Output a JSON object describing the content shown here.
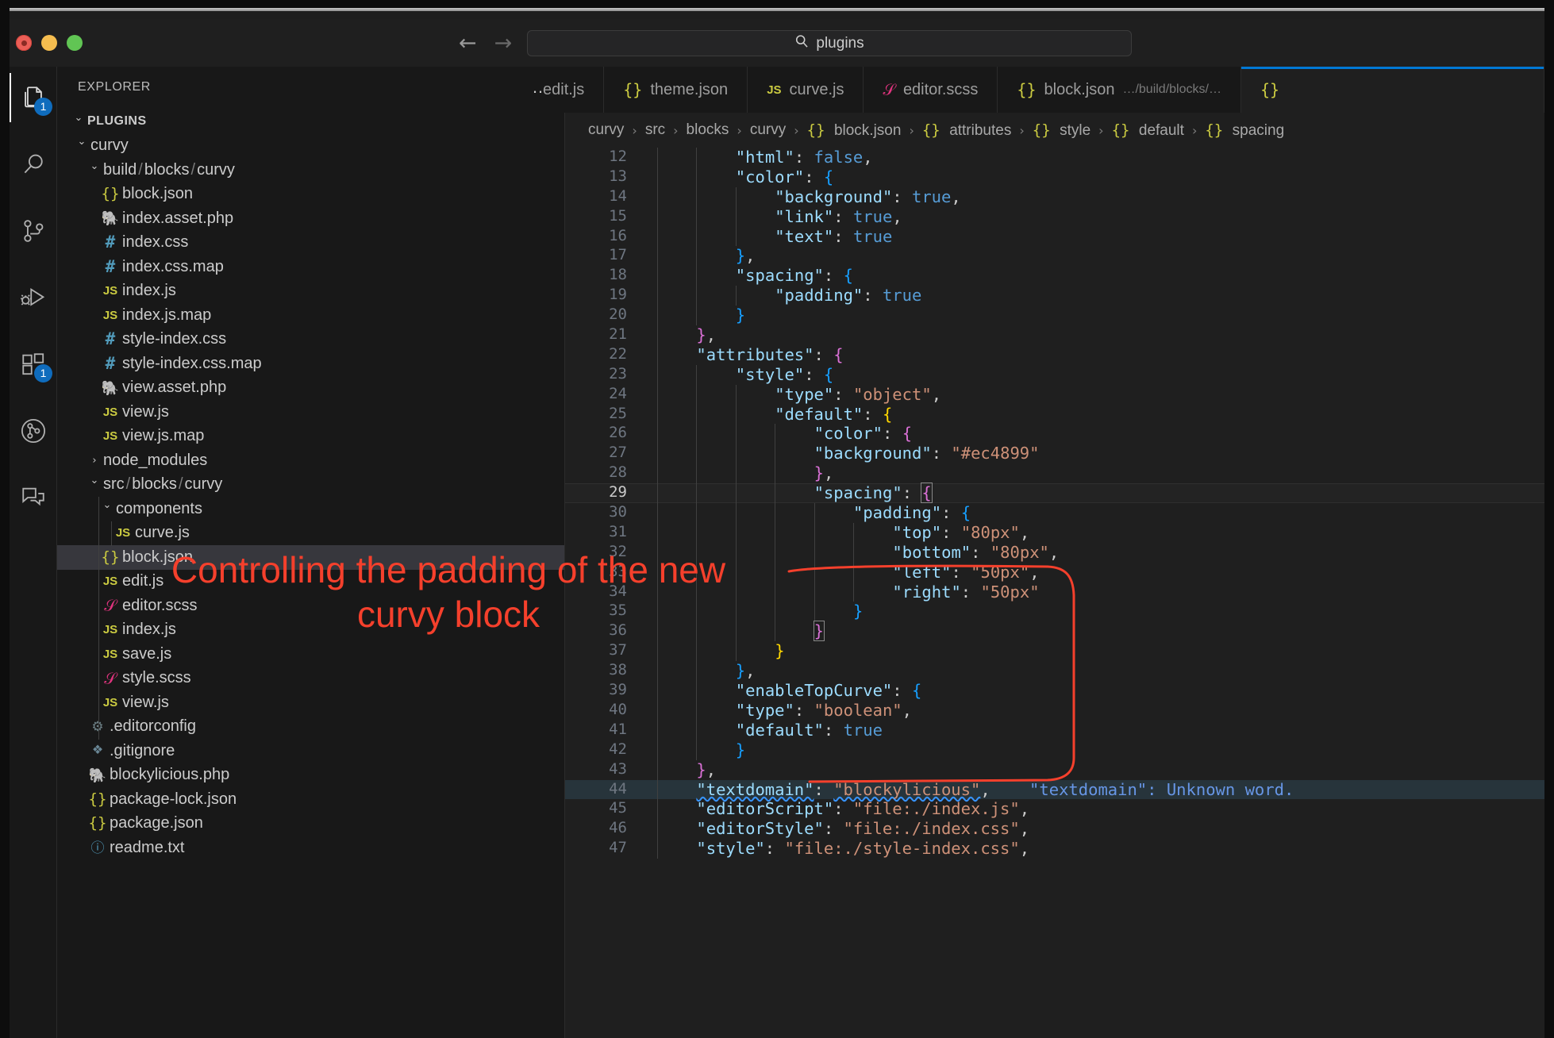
{
  "window": {
    "traffic_lights": [
      "close",
      "minimize",
      "maximize"
    ],
    "search_placeholder": "plugins",
    "search_value": "plugins",
    "nav_back": "←",
    "nav_forward": "→",
    "search_icon": "⌕"
  },
  "activitybar": {
    "items": [
      {
        "name": "explorer",
        "icon": "files-icon",
        "badge": "1",
        "active": true
      },
      {
        "name": "search",
        "icon": "search-icon",
        "badge": "",
        "active": false
      },
      {
        "name": "source-control",
        "icon": "source-control-icon",
        "badge": "",
        "active": false
      },
      {
        "name": "run-and-debug",
        "icon": "run-debug-icon",
        "badge": "",
        "active": false
      },
      {
        "name": "extensions",
        "icon": "extensions-icon",
        "badge": "1",
        "active": false
      },
      {
        "name": "git-graph",
        "icon": "git-graph-icon",
        "badge": "",
        "active": false
      },
      {
        "name": "comments",
        "icon": "comments-icon",
        "badge": "",
        "active": false
      }
    ]
  },
  "sidebar": {
    "title": "EXPLORER",
    "more_actions": "…",
    "root": {
      "label": "PLUGINS",
      "expanded": true
    },
    "tree": [
      {
        "label": "curvy",
        "kind": "folder",
        "depth": 1,
        "expanded": true,
        "icon": "chevron-down-icon"
      },
      {
        "label": "build",
        "label2": "blocks",
        "label3": "curvy",
        "kind": "folder-compact",
        "depth": 2,
        "expanded": true,
        "icon": "chevron-down-icon"
      },
      {
        "label": "block.json",
        "kind": "file",
        "depth": 3,
        "icon": "json-icon"
      },
      {
        "label": "index.asset.php",
        "kind": "file",
        "depth": 3,
        "icon": "php-icon"
      },
      {
        "label": "index.css",
        "kind": "file",
        "depth": 3,
        "icon": "css-icon"
      },
      {
        "label": "index.css.map",
        "kind": "file",
        "depth": 3,
        "icon": "css-icon"
      },
      {
        "label": "index.js",
        "kind": "file",
        "depth": 3,
        "icon": "js-icon"
      },
      {
        "label": "index.js.map",
        "kind": "file",
        "depth": 3,
        "icon": "js-icon"
      },
      {
        "label": "style-index.css",
        "kind": "file",
        "depth": 3,
        "icon": "css-icon"
      },
      {
        "label": "style-index.css.map",
        "kind": "file",
        "depth": 3,
        "icon": "css-icon"
      },
      {
        "label": "view.asset.php",
        "kind": "file",
        "depth": 3,
        "icon": "php-icon"
      },
      {
        "label": "view.js",
        "kind": "file",
        "depth": 3,
        "icon": "js-icon"
      },
      {
        "label": "view.js.map",
        "kind": "file",
        "depth": 3,
        "icon": "js-icon"
      },
      {
        "label": "node_modules",
        "kind": "folder",
        "depth": 2,
        "expanded": false,
        "icon": "chevron-right-icon"
      },
      {
        "label": "src",
        "label2": "blocks",
        "label3": "curvy",
        "kind": "folder-compact",
        "depth": 2,
        "expanded": true,
        "icon": "chevron-down-icon"
      },
      {
        "label": "components",
        "kind": "folder",
        "depth": 3,
        "expanded": true,
        "icon": "chevron-down-icon"
      },
      {
        "label": "curve.js",
        "kind": "file",
        "depth": 4,
        "icon": "js-icon"
      },
      {
        "label": "block.json",
        "kind": "file",
        "depth": 3,
        "icon": "json-icon",
        "selected": true
      },
      {
        "label": "edit.js",
        "kind": "file",
        "depth": 3,
        "icon": "js-icon"
      },
      {
        "label": "editor.scss",
        "kind": "file",
        "depth": 3,
        "icon": "scss-icon"
      },
      {
        "label": "index.js",
        "kind": "file",
        "depth": 3,
        "icon": "js-icon"
      },
      {
        "label": "save.js",
        "kind": "file",
        "depth": 3,
        "icon": "js-icon"
      },
      {
        "label": "style.scss",
        "kind": "file",
        "depth": 3,
        "icon": "scss-icon"
      },
      {
        "label": "view.js",
        "kind": "file",
        "depth": 3,
        "icon": "js-icon"
      },
      {
        "label": ".editorconfig",
        "kind": "file",
        "depth": 2,
        "icon": "gear-icon"
      },
      {
        "label": ".gitignore",
        "kind": "file",
        "depth": 2,
        "icon": "git-icon"
      },
      {
        "label": "blockylicious.php",
        "kind": "file",
        "depth": 2,
        "icon": "php-icon"
      },
      {
        "label": "package-lock.json",
        "kind": "file",
        "depth": 2,
        "icon": "json-icon"
      },
      {
        "label": "package.json",
        "kind": "file",
        "depth": 2,
        "icon": "json-icon"
      },
      {
        "label": "readme.txt",
        "kind": "file",
        "depth": 2,
        "icon": "txt-icon"
      }
    ]
  },
  "tabs": [
    {
      "label": "edit.js",
      "icon": "js-icon",
      "sub": "",
      "active": false,
      "clipped": true
    },
    {
      "label": "theme.json",
      "icon": "json-icon",
      "sub": "",
      "active": false
    },
    {
      "label": "curve.js",
      "icon": "js-icon",
      "sub": "",
      "active": false
    },
    {
      "label": "editor.scss",
      "icon": "scss-icon",
      "sub": "",
      "active": false
    },
    {
      "label": "block.json",
      "icon": "json-icon",
      "sub": "…/build/blocks/…",
      "active": false
    },
    {
      "label": "",
      "icon": "json-icon",
      "sub": "",
      "active": true
    }
  ],
  "breadcrumbs": [
    {
      "label": "curvy",
      "icon": ""
    },
    {
      "label": "src",
      "icon": ""
    },
    {
      "label": "blocks",
      "icon": ""
    },
    {
      "label": "curvy",
      "icon": ""
    },
    {
      "label": "block.json",
      "icon": "{}"
    },
    {
      "label": "attributes",
      "icon": "{}"
    },
    {
      "label": "style",
      "icon": "{}"
    },
    {
      "label": "default",
      "icon": "{}"
    },
    {
      "label": "spacing",
      "icon": "{}"
    }
  ],
  "code": {
    "first_line": 12,
    "current_line": 29,
    "lines": [
      {
        "n": 12,
        "indent": 2,
        "tokens": [
          {
            "t": "\"html\"",
            "c": "k"
          },
          {
            "t": ": ",
            "c": "p"
          },
          {
            "t": "false",
            "c": "b"
          },
          {
            "t": ",",
            "c": "p"
          }
        ]
      },
      {
        "n": 13,
        "indent": 2,
        "tokens": [
          {
            "t": "\"color\"",
            "c": "k"
          },
          {
            "t": ": ",
            "c": "p"
          },
          {
            "t": "{",
            "c": "bk3"
          }
        ]
      },
      {
        "n": 14,
        "indent": 3,
        "tokens": [
          {
            "t": "\"background\"",
            "c": "k"
          },
          {
            "t": ": ",
            "c": "p"
          },
          {
            "t": "true",
            "c": "b"
          },
          {
            "t": ",",
            "c": "p"
          }
        ]
      },
      {
        "n": 15,
        "indent": 3,
        "tokens": [
          {
            "t": "\"link\"",
            "c": "k"
          },
          {
            "t": ": ",
            "c": "p"
          },
          {
            "t": "true",
            "c": "b"
          },
          {
            "t": ",",
            "c": "p"
          }
        ]
      },
      {
        "n": 16,
        "indent": 3,
        "tokens": [
          {
            "t": "\"text\"",
            "c": "k"
          },
          {
            "t": ": ",
            "c": "p"
          },
          {
            "t": "true",
            "c": "b"
          }
        ]
      },
      {
        "n": 17,
        "indent": 2,
        "tokens": [
          {
            "t": "}",
            "c": "bk3"
          },
          {
            "t": ",",
            "c": "p"
          }
        ]
      },
      {
        "n": 18,
        "indent": 2,
        "tokens": [
          {
            "t": "\"spacing\"",
            "c": "k"
          },
          {
            "t": ": ",
            "c": "p"
          },
          {
            "t": "{",
            "c": "bk3"
          }
        ]
      },
      {
        "n": 19,
        "indent": 3,
        "tokens": [
          {
            "t": "\"padding\"",
            "c": "k"
          },
          {
            "t": ": ",
            "c": "p"
          },
          {
            "t": "true",
            "c": "b"
          }
        ]
      },
      {
        "n": 20,
        "indent": 2,
        "tokens": [
          {
            "t": "}",
            "c": "bk3"
          }
        ]
      },
      {
        "n": 21,
        "indent": 1,
        "tokens": [
          {
            "t": "}",
            "c": "bk2"
          },
          {
            "t": ",",
            "c": "p"
          }
        ]
      },
      {
        "n": 22,
        "indent": 1,
        "tokens": [
          {
            "t": "\"attributes\"",
            "c": "k"
          },
          {
            "t": ": ",
            "c": "p"
          },
          {
            "t": "{",
            "c": "bk2"
          }
        ]
      },
      {
        "n": 23,
        "indent": 2,
        "tokens": [
          {
            "t": "\"style\"",
            "c": "k"
          },
          {
            "t": ": ",
            "c": "p"
          },
          {
            "t": "{",
            "c": "bk3"
          }
        ]
      },
      {
        "n": 24,
        "indent": 3,
        "tokens": [
          {
            "t": "\"type\"",
            "c": "k"
          },
          {
            "t": ": ",
            "c": "p"
          },
          {
            "t": "\"object\"",
            "c": "s"
          },
          {
            "t": ",",
            "c": "p"
          }
        ]
      },
      {
        "n": 25,
        "indent": 3,
        "tokens": [
          {
            "t": "\"default\"",
            "c": "k"
          },
          {
            "t": ": ",
            "c": "p"
          },
          {
            "t": "{",
            "c": "bk1"
          }
        ]
      },
      {
        "n": 26,
        "indent": 4,
        "tokens": [
          {
            "t": "\"color\"",
            "c": "k"
          },
          {
            "t": ": ",
            "c": "p"
          },
          {
            "t": "{",
            "c": "bk2"
          }
        ]
      },
      {
        "n": 27,
        "indent": 4,
        "tokens": [
          {
            "t": "\"background\"",
            "c": "k"
          },
          {
            "t": ": ",
            "c": "p"
          },
          {
            "t": "\"#ec4899\"",
            "c": "s"
          }
        ]
      },
      {
        "n": 28,
        "indent": 4,
        "tokens": [
          {
            "t": "}",
            "c": "bk2"
          },
          {
            "t": ",",
            "c": "p"
          }
        ]
      },
      {
        "n": 29,
        "indent": 4,
        "tokens": [
          {
            "t": "\"spacing\"",
            "c": "k"
          },
          {
            "t": ": ",
            "c": "p"
          },
          {
            "t": "{",
            "c": "bk2 mbk"
          }
        ],
        "current": true
      },
      {
        "n": 30,
        "indent": 5,
        "tokens": [
          {
            "t": "\"padding\"",
            "c": "k"
          },
          {
            "t": ": ",
            "c": "p"
          },
          {
            "t": "{",
            "c": "bk3"
          }
        ]
      },
      {
        "n": 31,
        "indent": 6,
        "tokens": [
          {
            "t": "\"top\"",
            "c": "k"
          },
          {
            "t": ": ",
            "c": "p"
          },
          {
            "t": "\"80px\"",
            "c": "s"
          },
          {
            "t": ",",
            "c": "p"
          }
        ]
      },
      {
        "n": 32,
        "indent": 6,
        "tokens": [
          {
            "t": "\"bottom\"",
            "c": "k"
          },
          {
            "t": ": ",
            "c": "p"
          },
          {
            "t": "\"80px\"",
            "c": "s"
          },
          {
            "t": ",",
            "c": "p"
          }
        ]
      },
      {
        "n": 33,
        "indent": 6,
        "tokens": [
          {
            "t": "\"left\"",
            "c": "k"
          },
          {
            "t": ": ",
            "c": "p"
          },
          {
            "t": "\"50px\"",
            "c": "s"
          },
          {
            "t": ",",
            "c": "p"
          }
        ]
      },
      {
        "n": 34,
        "indent": 6,
        "tokens": [
          {
            "t": "\"right\"",
            "c": "k"
          },
          {
            "t": ": ",
            "c": "p"
          },
          {
            "t": "\"50px\"",
            "c": "s"
          }
        ]
      },
      {
        "n": 35,
        "indent": 5,
        "tokens": [
          {
            "t": "}",
            "c": "bk3"
          }
        ]
      },
      {
        "n": 36,
        "indent": 4,
        "tokens": [
          {
            "t": "}",
            "c": "bk2 mbk"
          }
        ]
      },
      {
        "n": 37,
        "indent": 3,
        "tokens": [
          {
            "t": "}",
            "c": "bk1"
          }
        ]
      },
      {
        "n": 38,
        "indent": 2,
        "tokens": [
          {
            "t": "}",
            "c": "bk3"
          },
          {
            "t": ",",
            "c": "p"
          }
        ]
      },
      {
        "n": 39,
        "indent": 2,
        "tokens": [
          {
            "t": "\"enableTopCurve\"",
            "c": "k"
          },
          {
            "t": ": ",
            "c": "p"
          },
          {
            "t": "{",
            "c": "bk3"
          }
        ]
      },
      {
        "n": 40,
        "indent": 2,
        "tokens": [
          {
            "t": "\"type\"",
            "c": "k"
          },
          {
            "t": ": ",
            "c": "p"
          },
          {
            "t": "\"boolean\"",
            "c": "s"
          },
          {
            "t": ",",
            "c": "p"
          }
        ]
      },
      {
        "n": 41,
        "indent": 2,
        "tokens": [
          {
            "t": "\"default\"",
            "c": "k"
          },
          {
            "t": ": ",
            "c": "p"
          },
          {
            "t": "true",
            "c": "b"
          }
        ]
      },
      {
        "n": 42,
        "indent": 2,
        "tokens": [
          {
            "t": "}",
            "c": "bk3"
          }
        ]
      },
      {
        "n": 43,
        "indent": 1,
        "tokens": [
          {
            "t": "}",
            "c": "bk2"
          },
          {
            "t": ",",
            "c": "p"
          }
        ]
      },
      {
        "n": 44,
        "indent": 1,
        "tokens": [
          {
            "t": "\"textdomain\"",
            "c": "k sq"
          },
          {
            "t": ": ",
            "c": "p"
          },
          {
            "t": "\"blockylicious\"",
            "c": "s sq"
          },
          {
            "t": ",",
            "c": "p"
          },
          {
            "t": "    ",
            "c": "p"
          },
          {
            "t": "\"textdomain\": Unknown word.",
            "c": "hint"
          }
        ],
        "highlight": true
      },
      {
        "n": 45,
        "indent": 1,
        "tokens": [
          {
            "t": "\"editorScript\"",
            "c": "k"
          },
          {
            "t": ": ",
            "c": "p"
          },
          {
            "t": "\"file:./index.js\"",
            "c": "s"
          },
          {
            "t": ",",
            "c": "p"
          }
        ]
      },
      {
        "n": 46,
        "indent": 1,
        "tokens": [
          {
            "t": "\"editorStyle\"",
            "c": "k"
          },
          {
            "t": ": ",
            "c": "p"
          },
          {
            "t": "\"file:./index.css\"",
            "c": "s"
          },
          {
            "t": ",",
            "c": "p"
          }
        ]
      },
      {
        "n": 47,
        "indent": 1,
        "tokens": [
          {
            "t": "\"style\"",
            "c": "k"
          },
          {
            "t": ": ",
            "c": "p"
          },
          {
            "t": "\"file:./style-index.css\"",
            "c": "s"
          },
          {
            "t": ",",
            "c": "p"
          }
        ]
      }
    ]
  },
  "annotations": {
    "callout_text": "Controlling the padding of the new\ncurvy block",
    "callout_color": "#f5402c",
    "highlight_box": {
      "target": "spacing attribute lines 29-37",
      "color": "#f5402c"
    }
  }
}
